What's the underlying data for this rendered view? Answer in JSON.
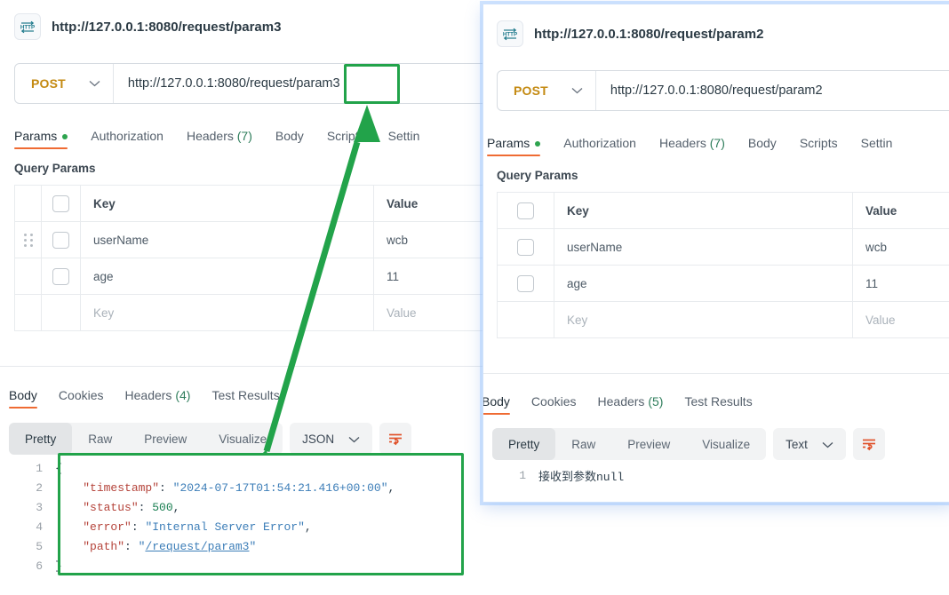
{
  "colors": {
    "accent_orange": "#ef6b33",
    "method_amber": "#c48a12",
    "annotation_green": "#22a34a",
    "focus_blue": "#96c3ff",
    "green_dot": "#2ea44f"
  },
  "left_request": {
    "icon": "http-protocol-icon",
    "title": "http://127.0.0.1:8080/request/param3",
    "url_bar": {
      "method": "POST",
      "method_caret": "chevron-down-icon",
      "url": "http://127.0.0.1:8080/request/param3"
    },
    "tabs": [
      {
        "label": "Params",
        "has_dot": true,
        "active": true
      },
      {
        "label": "Authorization",
        "has_dot": false,
        "active": false
      },
      {
        "label": "Headers",
        "count": "(7)",
        "active": false
      },
      {
        "label": "Body",
        "active": false
      },
      {
        "label": "Scripts",
        "active": false
      },
      {
        "label": "Settin",
        "active": false
      }
    ],
    "params_section_title": "Query Params",
    "params_table": {
      "columns": [
        "Key",
        "Value"
      ],
      "rows": [
        {
          "key": "userName",
          "value": "wcb",
          "has_handle": true,
          "has_checkbox": true,
          "placeholder": false
        },
        {
          "key": "age",
          "value": "11",
          "has_handle": false,
          "has_checkbox": true,
          "placeholder": false
        },
        {
          "key": "Key",
          "value": "Value",
          "has_handle": false,
          "has_checkbox": false,
          "placeholder": true
        }
      ]
    },
    "response": {
      "tabs": [
        {
          "label": "Body",
          "active": true
        },
        {
          "label": "Cookies",
          "active": false
        },
        {
          "label": "Headers",
          "count": "(4)",
          "active": false
        },
        {
          "label": "Test Results",
          "active": false
        }
      ],
      "view_modes": [
        {
          "label": "Pretty",
          "active": true
        },
        {
          "label": "Raw",
          "active": false
        },
        {
          "label": "Preview",
          "active": false
        },
        {
          "label": "Visualize",
          "active": false
        }
      ],
      "format": "JSON",
      "format_caret": "chevron-down-icon",
      "wrap_icon": "wrap-lines-icon",
      "body_lines": [
        {
          "num": "1",
          "tokens": [
            {
              "t": "{",
              "c": "punc"
            }
          ]
        },
        {
          "num": "2",
          "tokens": [
            {
              "t": "    ",
              "c": "punc"
            },
            {
              "t": "\"timestamp\"",
              "c": "k"
            },
            {
              "t": ": ",
              "c": "punc"
            },
            {
              "t": "\"2024-07-17T01:54:21.416+00:00\"",
              "c": "s"
            },
            {
              "t": ",",
              "c": "punc"
            }
          ]
        },
        {
          "num": "3",
          "tokens": [
            {
              "t": "    ",
              "c": "punc"
            },
            {
              "t": "\"status\"",
              "c": "k"
            },
            {
              "t": ": ",
              "c": "punc"
            },
            {
              "t": "500",
              "c": "n"
            },
            {
              "t": ",",
              "c": "punc"
            }
          ]
        },
        {
          "num": "4",
          "tokens": [
            {
              "t": "    ",
              "c": "punc"
            },
            {
              "t": "\"error\"",
              "c": "k"
            },
            {
              "t": ": ",
              "c": "punc"
            },
            {
              "t": "\"Internal Server Error\"",
              "c": "s"
            },
            {
              "t": ",",
              "c": "punc"
            }
          ]
        },
        {
          "num": "5",
          "tokens": [
            {
              "t": "    ",
              "c": "punc"
            },
            {
              "t": "\"path\"",
              "c": "k"
            },
            {
              "t": ": ",
              "c": "punc"
            },
            {
              "t": "\"",
              "c": "s"
            },
            {
              "t": "/request/param3",
              "c": "p"
            },
            {
              "t": "\"",
              "c": "s"
            }
          ]
        },
        {
          "num": "6",
          "tokens": [
            {
              "t": "}",
              "c": "punc"
            }
          ]
        }
      ]
    }
  },
  "right_request": {
    "icon": "http-protocol-icon",
    "title": "http://127.0.0.1:8080/request/param2",
    "url_bar": {
      "method": "POST",
      "method_caret": "chevron-down-icon",
      "url": "http://127.0.0.1:8080/request/param2"
    },
    "tabs": [
      {
        "label": "Params",
        "has_dot": true,
        "active": true
      },
      {
        "label": "Authorization",
        "has_dot": false,
        "active": false
      },
      {
        "label": "Headers",
        "count": "(7)",
        "active": false
      },
      {
        "label": "Body",
        "active": false
      },
      {
        "label": "Scripts",
        "active": false
      },
      {
        "label": "Settin",
        "active": false
      }
    ],
    "params_section_title": "Query Params",
    "params_table": {
      "columns": [
        "Key",
        "Value"
      ],
      "rows": [
        {
          "key": "userName",
          "value": "wcb",
          "has_handle": false,
          "has_checkbox": true,
          "placeholder": false
        },
        {
          "key": "age",
          "value": "11",
          "has_handle": false,
          "has_checkbox": true,
          "placeholder": false
        },
        {
          "key": "Key",
          "value": "Value",
          "has_handle": false,
          "has_checkbox": false,
          "placeholder": true
        }
      ]
    },
    "response": {
      "tabs": [
        {
          "label": "Body",
          "active": true
        },
        {
          "label": "Cookies",
          "active": false
        },
        {
          "label": "Headers",
          "count": "(5)",
          "active": false
        },
        {
          "label": "Test Results",
          "active": false
        }
      ],
      "view_modes": [
        {
          "label": "Pretty",
          "active": true
        },
        {
          "label": "Raw",
          "active": false
        },
        {
          "label": "Preview",
          "active": false
        },
        {
          "label": "Visualize",
          "active": false
        }
      ],
      "format": "Text",
      "format_caret": "chevron-down-icon",
      "wrap_icon": "wrap-lines-icon",
      "body_lines": [
        {
          "num": "1",
          "text": "接收到参数null"
        }
      ]
    }
  },
  "annotations": {
    "url_highlight_box": {
      "target": "param3 segment of request URL"
    },
    "json_highlight_box": {
      "target": "response body JSON"
    },
    "arrow": {
      "from": "response body JSON box",
      "to": "param3 segment of request URL"
    }
  }
}
